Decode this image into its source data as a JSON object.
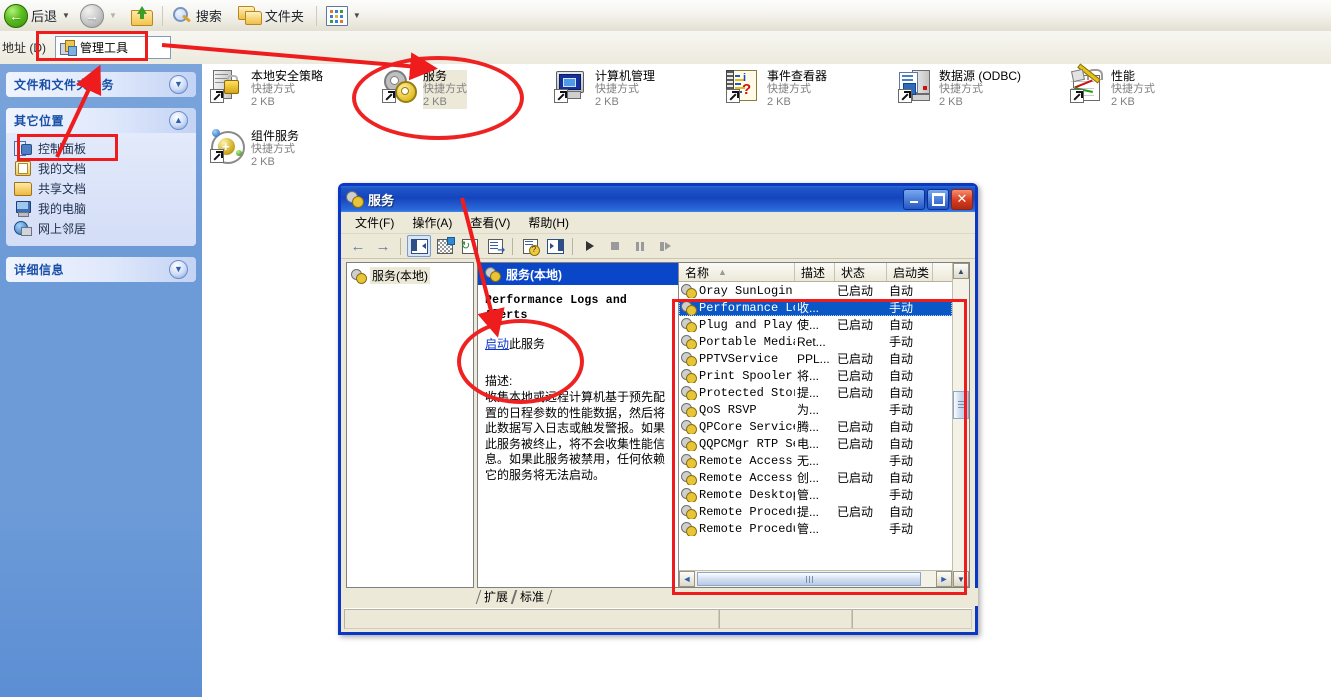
{
  "explorer": {
    "toolbar": {
      "back_label": "后退",
      "forward_label": "",
      "up_tooltip": "up-one-level",
      "search_label": "搜索",
      "folders_label": "文件夹",
      "views_label": ""
    },
    "address": {
      "label": "地址 (D)",
      "value": "管理工具"
    }
  },
  "sidebar": {
    "panels": [
      {
        "title": "文件和文件夹任务",
        "toggle": "▼",
        "items": []
      },
      {
        "title": "其它位置",
        "toggle": "▲",
        "items": [
          {
            "label": "控制面板",
            "icon": "control-panel-icon"
          },
          {
            "label": "我的文档",
            "icon": "my-documents-icon"
          },
          {
            "label": "共享文档",
            "icon": "shared-documents-icon"
          },
          {
            "label": "我的电脑",
            "icon": "my-computer-icon"
          },
          {
            "label": "网上邻居",
            "icon": "network-places-icon"
          }
        ]
      },
      {
        "title": "详细信息",
        "toggle": "▼",
        "items": []
      }
    ]
  },
  "icons": [
    {
      "name": "本地安全策略",
      "type": "快捷方式",
      "size": "2 KB",
      "icon": "local-security-policy-icon",
      "selected": false
    },
    {
      "name": "组件服务",
      "type": "快捷方式",
      "size": "2 KB",
      "icon": "component-services-icon",
      "selected": false
    },
    {
      "name": "服务",
      "type": "快捷方式",
      "size": "2 KB",
      "icon": "services-icon",
      "selected": true
    },
    {
      "name": "计算机管理",
      "type": "快捷方式",
      "size": "2 KB",
      "icon": "computer-management-icon",
      "selected": false
    },
    {
      "name": "事件查看器",
      "type": "快捷方式",
      "size": "2 KB",
      "icon": "event-viewer-icon",
      "selected": false
    },
    {
      "name": "数据源 (ODBC)",
      "type": "快捷方式",
      "size": "2 KB",
      "icon": "odbc-data-sources-icon",
      "selected": false
    },
    {
      "name": "性能",
      "type": "快捷方式",
      "size": "2 KB",
      "icon": "performance-icon",
      "selected": false
    }
  ],
  "services_window": {
    "title": "服务",
    "menus": [
      "文件(F)",
      "操作(A)",
      "查看(V)",
      "帮助(H)"
    ],
    "window_buttons": {
      "minimize": "_",
      "maximize": "□",
      "close": "✕"
    },
    "tree_root": "服务(本地)",
    "detail": {
      "header": "服务(本地)",
      "service_name": "Performance Logs and Alerts",
      "action_link": "启动",
      "action_suffix": "此服务",
      "description_label": "描述:",
      "description": "收集本地或远程计算机基于预先配置的日程参数的性能数据，然后将此数据写入日志或触发警报。如果此服务被终止，将不会收集性能信息。如果此服务被禁用，任何依赖它的服务将无法启动。"
    },
    "list": {
      "columns": [
        "名称",
        "描述",
        "状态",
        "启动类"
      ],
      "sort_column": "名称",
      "sort_mark": "▲",
      "rows": [
        {
          "name": "Oray SunLogin ...",
          "desc": "",
          "status": "已启动",
          "startup": "自动",
          "selected": false
        },
        {
          "name": "Performance Lo...",
          "desc": "收...",
          "status": "",
          "startup": "手动",
          "selected": true
        },
        {
          "name": "Plug and Play",
          "desc": "使...",
          "status": "已启动",
          "startup": "自动",
          "selected": false
        },
        {
          "name": "Portable Media...",
          "desc": "Ret...",
          "status": "",
          "startup": "手动",
          "selected": false
        },
        {
          "name": "PPTVService",
          "desc": "PPL...",
          "status": "已启动",
          "startup": "自动",
          "selected": false
        },
        {
          "name": "Print Spooler",
          "desc": "将...",
          "status": "已启动",
          "startup": "自动",
          "selected": false
        },
        {
          "name": "Protected Storage",
          "desc": "提...",
          "status": "已启动",
          "startup": "自动",
          "selected": false
        },
        {
          "name": "QoS RSVP",
          "desc": "为...",
          "status": "",
          "startup": "手动",
          "selected": false
        },
        {
          "name": "QPCore Service",
          "desc": "腾...",
          "status": "已启动",
          "startup": "自动",
          "selected": false
        },
        {
          "name": "QQPCMgr RTP Se...",
          "desc": "电...",
          "status": "已启动",
          "startup": "自动",
          "selected": false
        },
        {
          "name": "Remote Access ...",
          "desc": "无...",
          "status": "",
          "startup": "手动",
          "selected": false
        },
        {
          "name": "Remote Access ...",
          "desc": "创...",
          "status": "已启动",
          "startup": "自动",
          "selected": false
        },
        {
          "name": "Remote Desktop...",
          "desc": "管...",
          "status": "",
          "startup": "手动",
          "selected": false
        },
        {
          "name": "Remote Procedu...",
          "desc": "提...",
          "status": "已启动",
          "startup": "自动",
          "selected": false
        },
        {
          "name": "Remote Procedu...",
          "desc": "管...",
          "status": "",
          "startup": "手动",
          "selected": false
        }
      ]
    },
    "tabs": [
      "扩展",
      "标准"
    ]
  },
  "colors": {
    "annotation_red": "#ee1c1c",
    "title_blue": "#0a46c8",
    "selection_blue": "#0a57c6",
    "sidebar_blue": "#6d9bd8"
  }
}
